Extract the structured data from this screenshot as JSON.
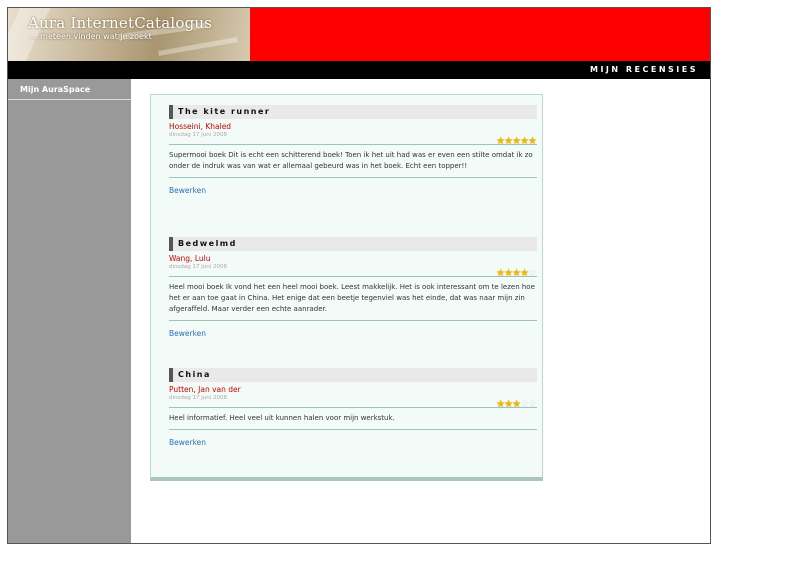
{
  "header": {
    "logo_title": "Aura InternetCatalogus",
    "logo_tagline": "... meteen vinden wat je zoekt",
    "nav_title": "Mijn Recensies",
    "banner_color": "#fe0000"
  },
  "sidebar": {
    "items": [
      {
        "label": "Mijn AuraSpace"
      }
    ]
  },
  "reviews": [
    {
      "title": "The kite runner",
      "author": "Hosseini, Khaled",
      "date": "dinsdag 17 juni 2008",
      "rating": 5,
      "max_rating": 5,
      "text": "Supermooi boek Dit is echt een schitterend boek! Toen ik het uit had was er even een stilte omdat ik zo onder de indruk was van wat er allemaal gebeurd was in het boek. Echt een topper!!",
      "edit_label": "Bewerken"
    },
    {
      "title": "Bedwelmd",
      "author": "Wang, Lulu",
      "date": "dinsdag 17 juni 2008",
      "rating": 4,
      "max_rating": 5,
      "text": "Heel mooi boek Ik vond het een heel mooi boek. Leest makkelijk. Het is ook interessant om te lezen hoe het er aan toe gaat in China. Het enige dat een beetje tegenviel was het einde, dat was naar mijn zin afgeraffeld. Maar verder een echte aanrader.",
      "edit_label": "Bewerken"
    },
    {
      "title": "China",
      "author": "Putten, Jan van der",
      "date": "dinsdag 17 juni 2008",
      "rating": 3,
      "max_rating": 5,
      "text": "Heel informatief. Heel veel uit kunnen halen voor mijn werkstuk.",
      "edit_label": "Bewerken"
    }
  ],
  "icons": {
    "star_filled": "star-icon",
    "star_empty": "star-empty-icon"
  },
  "colors": {
    "star": "#f5b800",
    "author": "#cc0000",
    "link": "#2d6fb7"
  }
}
